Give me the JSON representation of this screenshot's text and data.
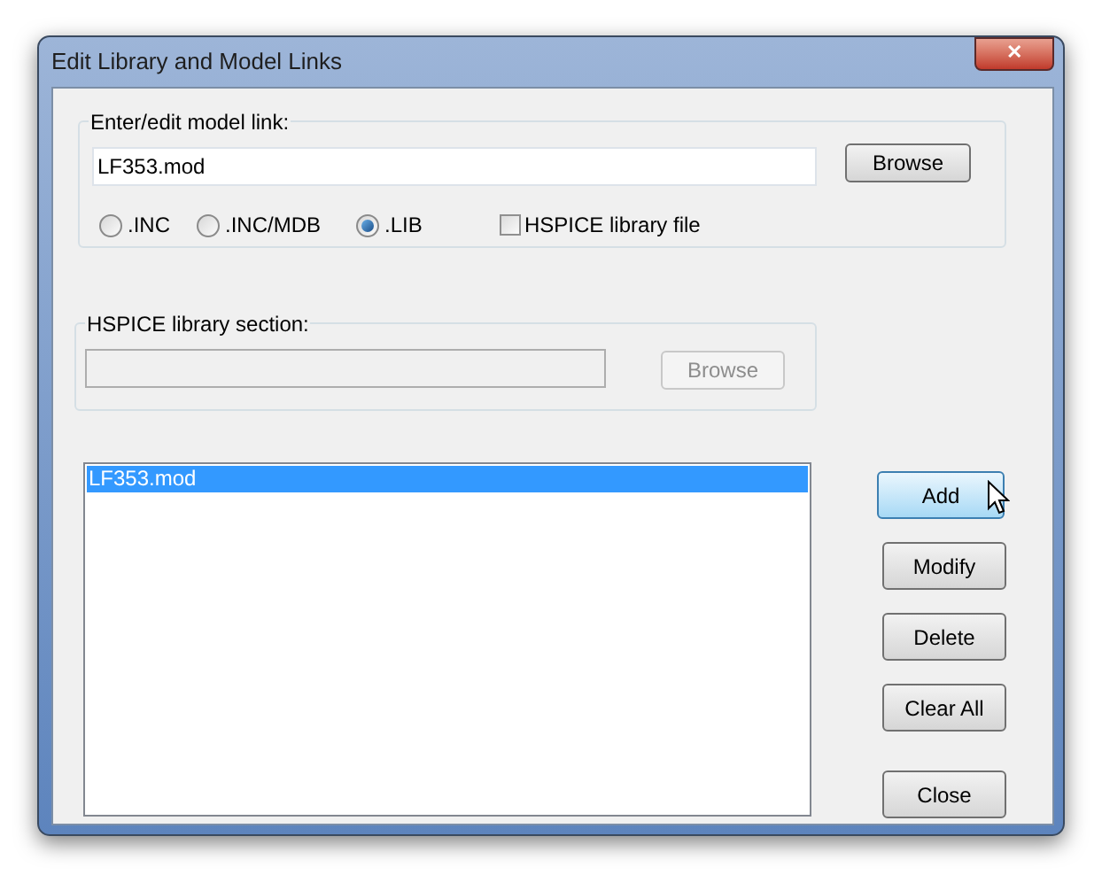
{
  "window": {
    "title": "Edit Library and Model Links",
    "close": "✕"
  },
  "model_link": {
    "label": "Enter/edit model link:",
    "value": "LF353.mod",
    "browse": {
      "label": "Browse",
      "disabled": false
    },
    "radios": [
      {
        "label": ".INC",
        "selected": false
      },
      {
        "label": ".INC/MDB",
        "selected": false
      },
      {
        "label": ".LIB",
        "selected": true
      }
    ],
    "hspice_checkbox": {
      "label": "HSPICE library file",
      "checked": false
    }
  },
  "library_section": {
    "label": "HSPICE library section:",
    "disabled": true,
    "browse": {
      "label": "Browse",
      "disabled": true
    }
  },
  "links_list": [
    {
      "label": "LF353.mod",
      "selected": true
    }
  ],
  "buttons": [
    {
      "label": "Add",
      "hovered": true
    },
    {
      "label": "Modify",
      "hovered": false
    },
    {
      "label": "Delete",
      "hovered": false
    },
    {
      "label": "Clear All",
      "hovered": false
    },
    {
      "label": "Close",
      "hovered": false
    }
  ]
}
